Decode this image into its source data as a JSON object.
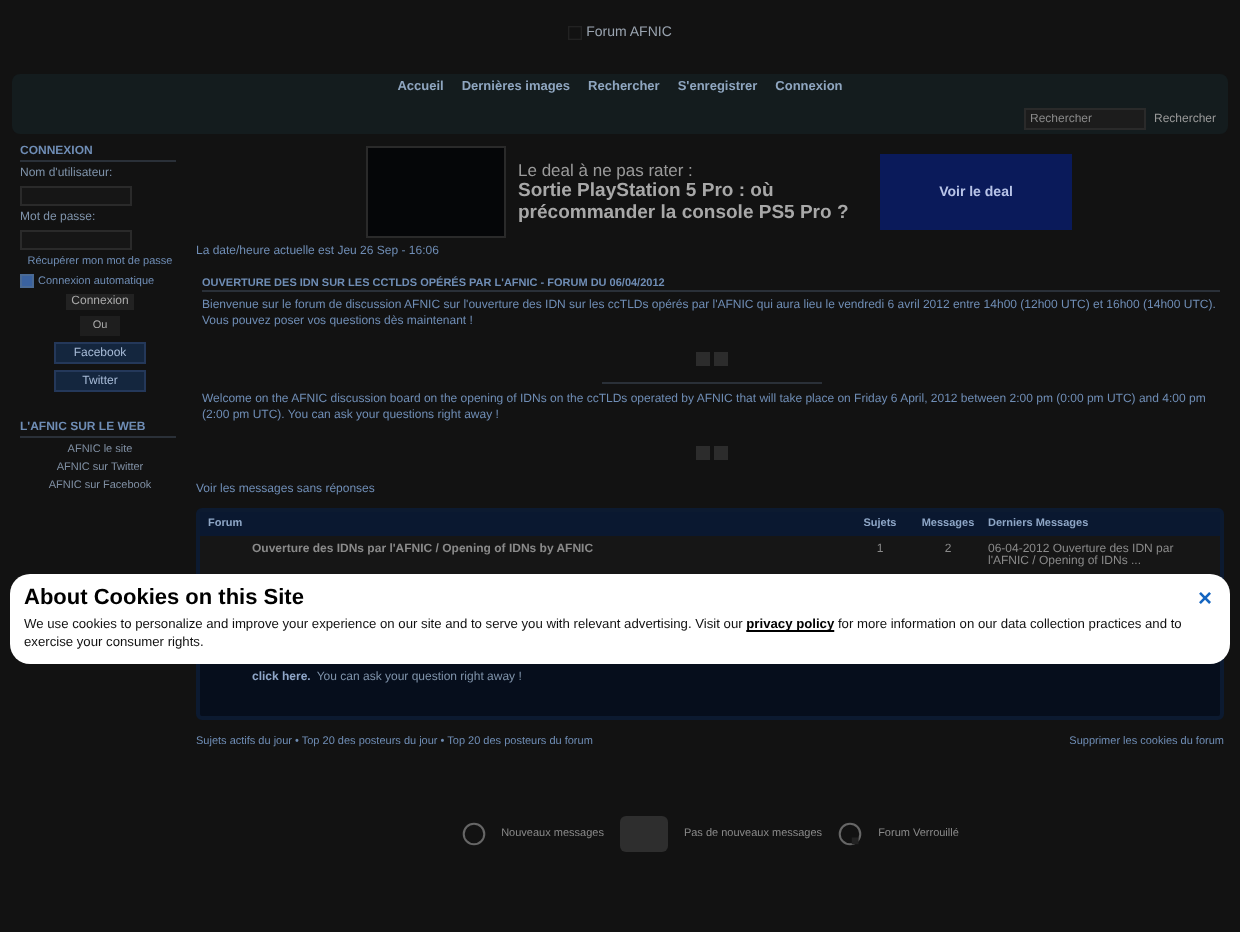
{
  "logo": {
    "alt": "Forum AFNIC"
  },
  "nav": {
    "items": [
      {
        "label": "Accueil"
      },
      {
        "label": "Dernières images"
      },
      {
        "label": "Rechercher"
      },
      {
        "label": "S'enregistrer"
      },
      {
        "label": "Connexion"
      }
    ],
    "search": {
      "placeholder": "Rechercher"
    },
    "search_button": "Rechercher"
  },
  "sidebar": {
    "login": {
      "title": "CONNEXION",
      "username_label": "Nom d'utilisateur:",
      "password_label": "Mot de passe:",
      "recover": "Récupérer mon mot de passe",
      "auto_login": {
        "label": "Connexion automatique",
        "checked": true
      },
      "submit": "Connexion",
      "or": "Ou",
      "social": [
        "Facebook",
        "Twitter"
      ]
    },
    "web": {
      "title": "L'AFNIC SUR LE WEB",
      "links": [
        "AFNIC le site",
        "AFNIC sur Twitter",
        "AFNIC sur Facebook"
      ]
    }
  },
  "ad": {
    "kicker": "Le deal à ne pas rater :",
    "headline": "Sortie PlayStation 5 Pro : où précommander la console PS5 Pro ?",
    "button": "Voir le deal"
  },
  "current_time": "La date/heure actuelle est Jeu 26 Sep - 16:06",
  "announcement": {
    "title": "OUVERTURE DES IDN SUR LES CCTLDS OPÉRÉS PAR L'AFNIC - FORUM DU 06/04/2012",
    "text_fr": "Bienvenue sur le forum de discussion AFNIC sur l'ouverture des IDN sur les ccTLDs opérés par l'AFNIC qui aura lieu le vendredi 6 avril 2012 entre 14h00 (12h00 UTC) et 16h00 (14h00 UTC). Vous pouvez poser vos questions dès maintenant !",
    "text_en": "Welcome on the AFNIC discussion board on the opening of IDNs on the ccTLDs operated by AFNIC that will take place on Friday 6 April, 2012 between 2:00 pm (0:00 pm UTC) and 4:00 pm (2:00 pm UTC). You can ask your questions right away !"
  },
  "unanswered_link": "Voir les messages sans réponses",
  "table": {
    "columns": [
      "Forum",
      "Sujets",
      "Messages",
      "Derniers Messages"
    ],
    "rows": [
      {
        "forum": "Ouverture des IDNs par l'AFNIC / Opening of IDNs by AFNIC",
        "topics": "1",
        "posts": "2",
        "last": "06-04-2012 Ouverture des IDN par l'AFNIC / Opening of IDNs ..."
      }
    ],
    "note_link": "click here.",
    "note": "You can ask your question right away !"
  },
  "footer": {
    "links_text": "Sujets actifs du jour • Top 20 des posteurs du jour • Top 20 des posteurs du forum",
    "delete_cookies": "Supprimer les cookies du forum"
  },
  "legend": [
    "Nouveaux messages",
    "Pas de nouveaux messages",
    "Forum Verrouillé"
  ],
  "cookie_banner": {
    "title": "About Cookies on this Site",
    "text": "We use cookies to personalize and improve your experience on our site and to serve you with relevant advertising. Visit our",
    "link": "privacy policy",
    "text_after": "for more information on our data collection practices and to exercise your consumer rights.",
    "close": "×"
  }
}
